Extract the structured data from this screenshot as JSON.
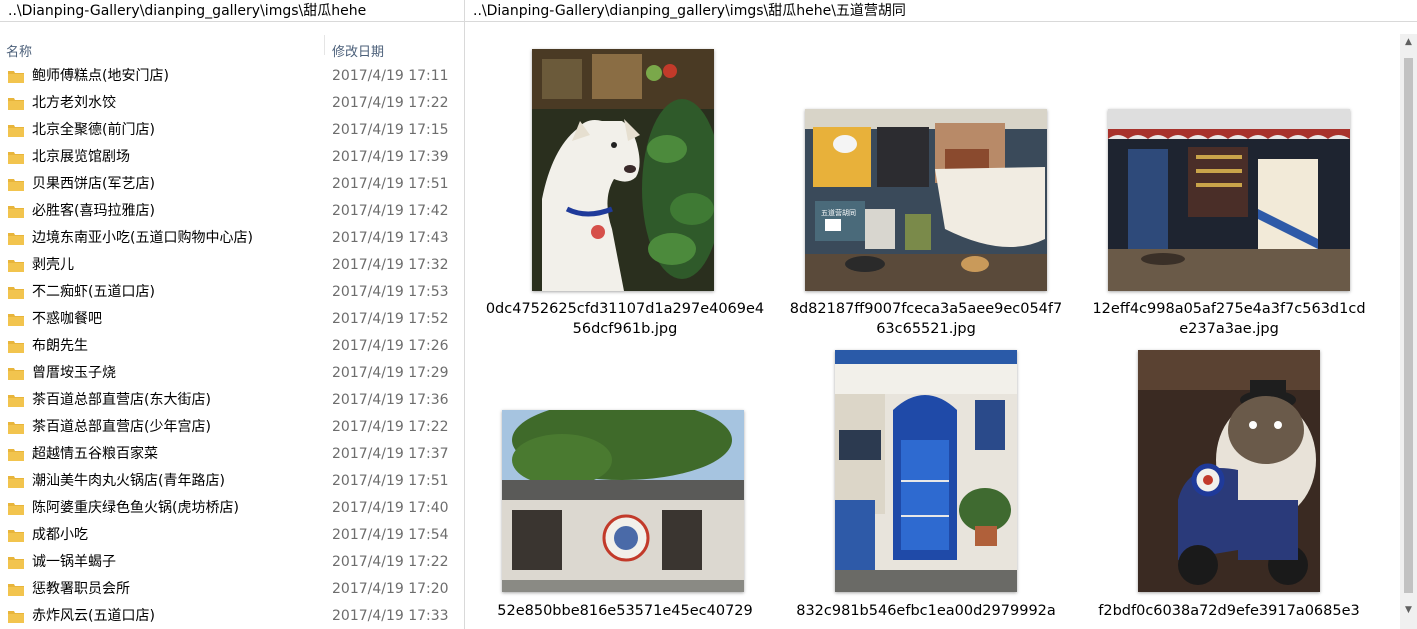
{
  "left_path": "..\\Dianping-Gallery\\dianping_gallery\\imgs\\甜瓜hehe",
  "right_path": "..\\Dianping-Gallery\\dianping_gallery\\imgs\\甜瓜hehe\\五道营胡同",
  "list": {
    "col_name": "名称",
    "col_date": "修改日期",
    "items": [
      {
        "name": "鲍师傅糕点(地安门店)",
        "date": "2017/4/19 17:11"
      },
      {
        "name": "北方老刘水饺",
        "date": "2017/4/19 17:22"
      },
      {
        "name": "北京全聚德(前门店)",
        "date": "2017/4/19 17:15"
      },
      {
        "name": "北京展览馆剧场",
        "date": "2017/4/19 17:39"
      },
      {
        "name": "贝果西饼店(军艺店)",
        "date": "2017/4/19 17:51"
      },
      {
        "name": "必胜客(喜玛拉雅店)",
        "date": "2017/4/19 17:42"
      },
      {
        "name": "边境东南亚小吃(五道口购物中心店)",
        "date": "2017/4/19 17:43"
      },
      {
        "name": "剥壳儿",
        "date": "2017/4/19 17:32"
      },
      {
        "name": "不二痴虾(五道口店)",
        "date": "2017/4/19 17:53"
      },
      {
        "name": "不惑咖餐吧",
        "date": "2017/4/19 17:52"
      },
      {
        "name": "布朗先生",
        "date": "2017/4/19 17:26"
      },
      {
        "name": "曾厝垵玉子烧",
        "date": "2017/4/19 17:29"
      },
      {
        "name": "茶百道总部直营店(东大街店)",
        "date": "2017/4/19 17:36"
      },
      {
        "name": "茶百道总部直营店(少年宫店)",
        "date": "2017/4/19 17:22"
      },
      {
        "name": "超越情五谷粮百家菜",
        "date": "2017/4/19 17:37"
      },
      {
        "name": "潮汕美牛肉丸火锅店(青年路店)",
        "date": "2017/4/19 17:51"
      },
      {
        "name": "陈阿婆重庆绿色鱼火锅(虎坊桥店)",
        "date": "2017/4/19 17:40"
      },
      {
        "name": "成都小吃",
        "date": "2017/4/19 17:54"
      },
      {
        "name": "诚一锅羊蝎子",
        "date": "2017/4/19 17:22"
      },
      {
        "name": "惩教署职员会所",
        "date": "2017/4/19 17:20"
      },
      {
        "name": "赤炸风云(五道口店)",
        "date": "2017/4/19 17:33"
      }
    ]
  },
  "gallery": [
    {
      "caption": "0dc4752625cfd31107d1a297e4069e456dcf961b.jpg",
      "icon": "dog-photo"
    },
    {
      "caption": "8d82187ff9007fceca3a5aee9ec054f763c65521.jpg",
      "icon": "shop-interior-photo"
    },
    {
      "caption": "12eff4c998a05af275e4a3f7c563d1cde237a3ae.jpg",
      "icon": "storefront-photo"
    },
    {
      "caption": "52e850bbe816e53571e45ec40729",
      "icon": "hutong-building-photo"
    },
    {
      "caption": "832c981b546efbc1ea00d2979992a",
      "icon": "blue-door-photo"
    },
    {
      "caption": "f2bdf0c6038a72d9efe3917a0685e3",
      "icon": "scooter-statue-photo"
    }
  ],
  "colors": {
    "folder": "#e8b53b",
    "header_text": "#4c607a",
    "date_text": "#6d6d6d"
  }
}
